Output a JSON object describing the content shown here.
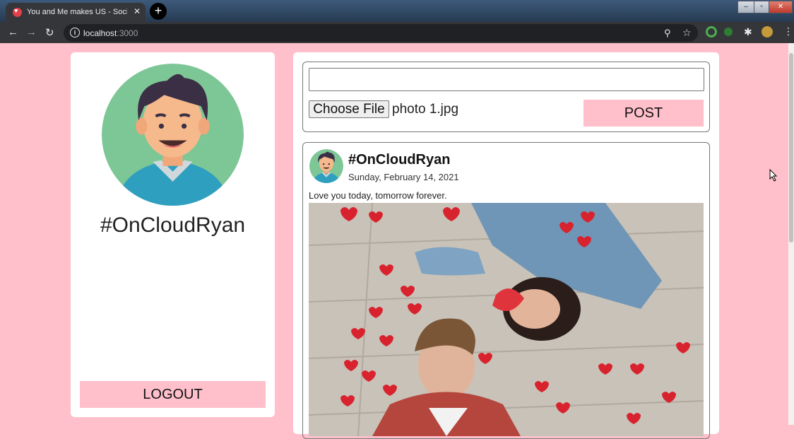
{
  "browser": {
    "tab_title": "You and Me makes US - Social Network",
    "new_tab_label": "+",
    "url_host": "localhost",
    "url_port": ":3000",
    "close_glyph": "✕",
    "controls": {
      "minimize": "‒",
      "maximize": "▫",
      "close": "✕"
    }
  },
  "sidebar": {
    "username": "#OnCloudRyan",
    "logout_label": "LOGOUT"
  },
  "composer": {
    "text_value": "",
    "choose_file_label": "Choose File",
    "file_name": "photo 1.jpg",
    "post_label": "POST"
  },
  "feed": [
    {
      "author": "#OnCloudRyan",
      "date": "Sunday, February 14, 2021",
      "caption": "Love you today, tomorrow forever."
    }
  ],
  "colors": {
    "page_background": "#ffc0cb",
    "button": "#ffc0cb",
    "avatar_bg": "#7dc696"
  },
  "icons": [
    "back-arrow-icon",
    "forward-arrow-icon",
    "reload-icon",
    "info-icon",
    "key-icon",
    "star-icon",
    "extension-icon",
    "profile-icon",
    "menu-icon"
  ]
}
